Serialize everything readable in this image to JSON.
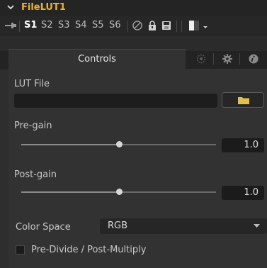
{
  "header": {
    "title": "FileLUT1"
  },
  "toolbar": {
    "slots": [
      "S1",
      "S2",
      "S3",
      "S4",
      "S5",
      "S6"
    ],
    "active_slot": "S1"
  },
  "tabs": {
    "controls_label": "Controls"
  },
  "lut_file": {
    "label": "LUT File",
    "value": ""
  },
  "pre_gain": {
    "label": "Pre-gain",
    "value": "1.0",
    "level": 0.5
  },
  "post_gain": {
    "label": "Post-gain",
    "value": "1.0",
    "level": 0.5
  },
  "color_space": {
    "label": "Color Space",
    "value": "RGB"
  },
  "pre_divide": {
    "label": "Pre-Divide / Post-Multiply",
    "checked": false
  },
  "colors": {
    "title": "#e8b23a",
    "folder": "#e0c04a"
  },
  "icons": [
    "chevron-down-icon",
    "pin-icon",
    "disable-icon",
    "lock-icon",
    "save-icon",
    "color-swatch-icon",
    "dropdown-arrow-icon",
    "mask-icon",
    "gear-icon",
    "info-icon",
    "folder-icon"
  ]
}
